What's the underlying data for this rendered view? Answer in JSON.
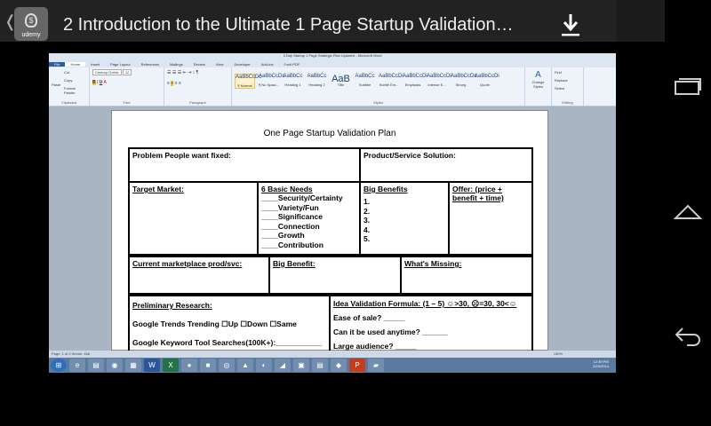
{
  "app": {
    "title": "2  Introduction to the Ultimate 1 Page Startup Validation…",
    "app_icon_label": "udemy"
  },
  "word": {
    "window_title": "3 Day Startup 1 Page Strategic Plan Updated - Microsoft Word",
    "tabs": [
      "File",
      "Home",
      "Insert",
      "Page Layout",
      "References",
      "Mailings",
      "Review",
      "View",
      "Developer",
      "Add-Ins",
      "Foxit PDF"
    ],
    "clipboard": {
      "paste": "Paste",
      "cut": "Cut",
      "copy": "Copy",
      "format_painter": "Format Painter",
      "label": "Clipboard"
    },
    "font": {
      "name": "Century Gothic",
      "size": "12",
      "label": "Font"
    },
    "paragraph_label": "Paragraph",
    "styles": [
      {
        "sample": "AaBbCcDc",
        "name": "¶ Normal"
      },
      {
        "sample": "AaBbCcDc",
        "name": "¶ No Spaci..."
      },
      {
        "sample": "AaBbCc",
        "name": "Heading 1"
      },
      {
        "sample": "AaBbCc",
        "name": "Heading 2"
      },
      {
        "sample": "AaB",
        "name": "Title"
      },
      {
        "sample": "AaBbCc",
        "name": "Subtitle"
      },
      {
        "sample": "AaBbCcDi",
        "name": "Subtle Em..."
      },
      {
        "sample": "AaBbCcDi",
        "name": "Emphasis"
      },
      {
        "sample": "AaBbCcDi",
        "name": "Intense E..."
      },
      {
        "sample": "AaBbCcDc",
        "name": "Strong"
      },
      {
        "sample": "AaBbCcDi",
        "name": "Quote"
      }
    ],
    "styles_label": "Styles",
    "change_styles": "Change Styles",
    "editing": {
      "find": "Find",
      "replace": "Replace",
      "select": "Select",
      "label": "Editing"
    },
    "status": "Page: 1 of 2   Words: 466",
    "zoom": "150%",
    "clock": {
      "time": "12:39 PM",
      "date": "2/24/2014"
    }
  },
  "doc": {
    "title": "One Page Startup Validation Plan",
    "problem": "Problem People want fixed:",
    "solution": "Product/Service  Solution:",
    "target": "Target Market:",
    "needs_title": "6 Basic Needs",
    "needs": [
      "____Security/Certainty",
      "____Variety/Fun",
      "____Significance",
      "____Connection",
      "____Growth",
      "____Contribution"
    ],
    "benefits_title": "Big Benefits",
    "benefits": [
      "1.",
      "2.",
      "3.",
      "4.",
      "5."
    ],
    "offer": "Offer: (price + benefit + time)",
    "current": "Current marketplace prod/svc:",
    "big_benefit": "Big Benefit:",
    "missing": "What's Missing:",
    "prelim": "Preliminary Research:",
    "trends": "Google Trends Trending   ☐Up   ☐Down  ☐Same",
    "keyword": "Google Keyword Tool Searches(100K+):___________",
    "formula": "Idea Validation Formula: (1 – 5) ☺>30, ☹=30, 30<☺",
    "q1": "Ease of sale? _____",
    "q2": "Can it be used anytime? ______",
    "q3": "Large audience? _____"
  }
}
